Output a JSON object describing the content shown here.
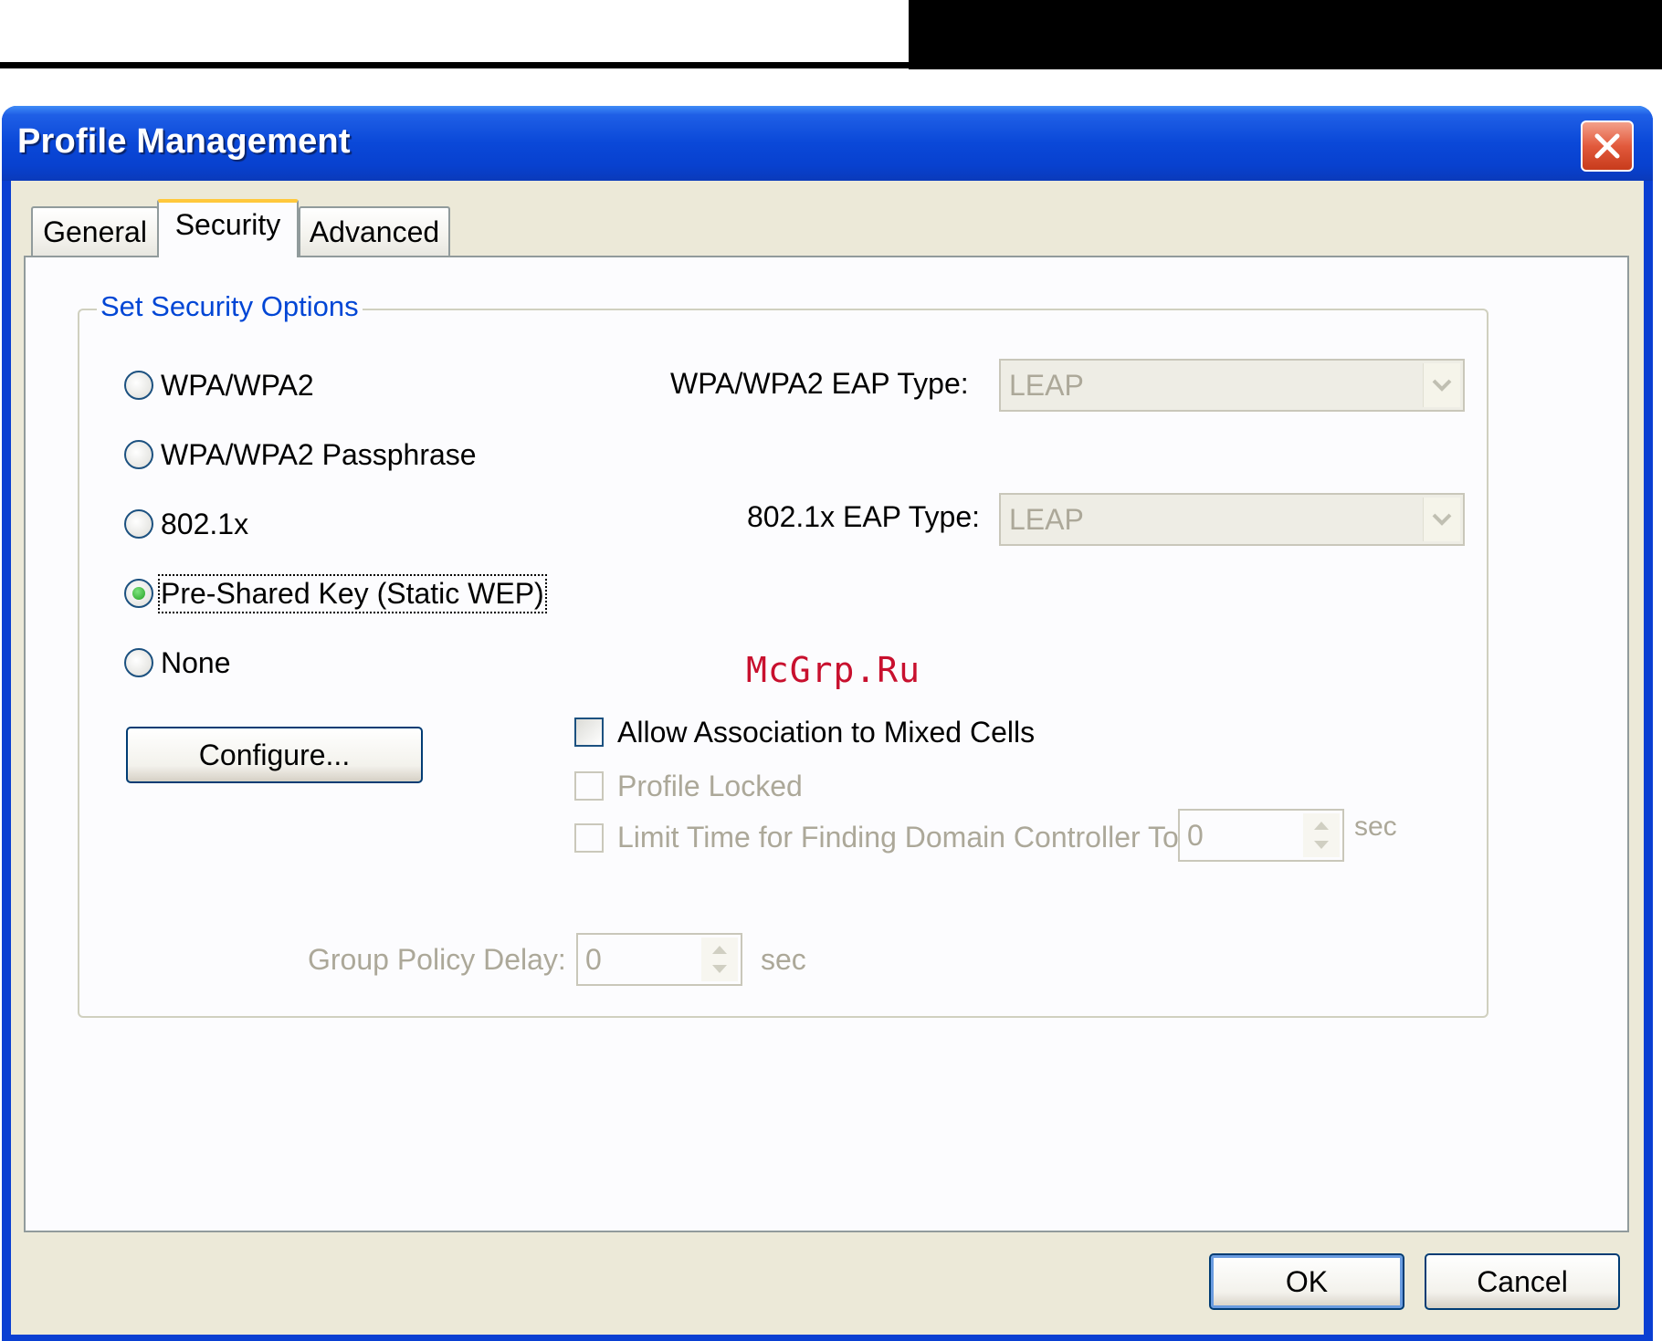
{
  "window": {
    "title": "Profile Management"
  },
  "tabs": [
    {
      "label": "General",
      "active": false
    },
    {
      "label": "Security",
      "active": true
    },
    {
      "label": "Advanced",
      "active": false
    }
  ],
  "security": {
    "group_title": "Set Security Options",
    "options": [
      {
        "label": "WPA/WPA2",
        "selected": false
      },
      {
        "label": "WPA/WPA2 Passphrase",
        "selected": false
      },
      {
        "label": "802.1x",
        "selected": false
      },
      {
        "label": "Pre-Shared Key (Static WEP)",
        "selected": true
      },
      {
        "label": "None",
        "selected": false
      }
    ],
    "wpa_eap_label": "WPA/WPA2 EAP Type:",
    "wpa_eap_value": "LEAP",
    "dot1x_eap_label": "802.1x EAP Type:",
    "dot1x_eap_value": "LEAP",
    "configure_label": "Configure...",
    "allow_mixed_label": "Allow Association to Mixed Cells",
    "allow_mixed_checked": false,
    "profile_locked_label": "Profile Locked",
    "limit_time_label": "Limit Time for Finding Domain Controller To:",
    "limit_time_value": "0",
    "limit_time_unit": "sec",
    "group_policy_label": "Group Policy Delay:",
    "group_policy_value": "0",
    "group_policy_unit": "sec"
  },
  "buttons": {
    "ok": "OK",
    "cancel": "Cancel"
  },
  "watermark": "McGrp.Ru",
  "colors": {
    "titlebar": "#0a48d8",
    "group_title": "#0046d5",
    "disabled_text": "#aca899",
    "watermark": "#c8102e"
  }
}
